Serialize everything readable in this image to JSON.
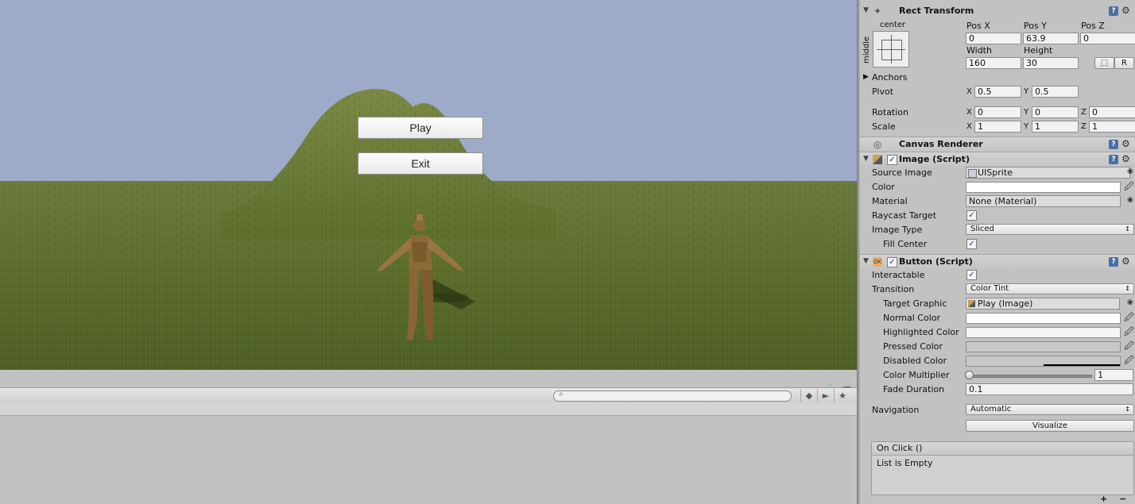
{
  "game_view": {
    "buttons": [
      "Play",
      "Exit"
    ],
    "sky_color": "#9dabc8",
    "ground_color": "#5b6f2d"
  },
  "bottom_panel": {
    "search_placeholder": ""
  },
  "inspector": {
    "rect_transform": {
      "title": "Rect Transform",
      "anchor_h": "center",
      "anchor_v": "middle",
      "pos_x_label": "Pos X",
      "pos_y_label": "Pos Y",
      "pos_z_label": "Pos Z",
      "pos_x": "0",
      "pos_y": "63.9",
      "pos_z": "0",
      "width_label": "Width",
      "height_label": "Height",
      "width": "160",
      "height": "30",
      "r_button": "R",
      "anchors_label": "Anchors",
      "pivot_label": "Pivot",
      "pivot_x": "0.5",
      "pivot_y": "0.5",
      "rotation_label": "Rotation",
      "rot_x": "0",
      "rot_y": "0",
      "rot_z": "0",
      "scale_label": "Scale",
      "scale_x": "1",
      "scale_y": "1",
      "scale_z": "1",
      "x": "X",
      "y": "Y",
      "z": "Z"
    },
    "canvas_renderer": {
      "title": "Canvas Renderer"
    },
    "image_script": {
      "title": "Image (Script)",
      "source_image_label": "Source Image",
      "source_image": "UISprite",
      "color_label": "Color",
      "material_label": "Material",
      "material": "None (Material)",
      "raycast_label": "Raycast Target",
      "image_type_label": "Image Type",
      "image_type": "Sliced",
      "fill_center_label": "Fill Center"
    },
    "button_script": {
      "title": "Button (Script)",
      "interactable_label": "Interactable",
      "transition_label": "Transition",
      "transition": "Color Tint",
      "target_graphic_label": "Target Graphic",
      "target_graphic": "Play (Image)",
      "normal_color_label": "Normal Color",
      "highlighted_color_label": "Highlighted Color",
      "pressed_color_label": "Pressed Color",
      "disabled_color_label": "Disabled Color",
      "color_multiplier_label": "Color Multiplier",
      "color_multiplier": "1",
      "fade_duration_label": "Fade Duration",
      "fade_duration": "0.1",
      "navigation_label": "Navigation",
      "navigation": "Automatic",
      "visualize_button": "Visualize",
      "on_click_label": "On Click ()",
      "list_empty": "List is Empty",
      "plus": "+",
      "minus": "−"
    }
  }
}
